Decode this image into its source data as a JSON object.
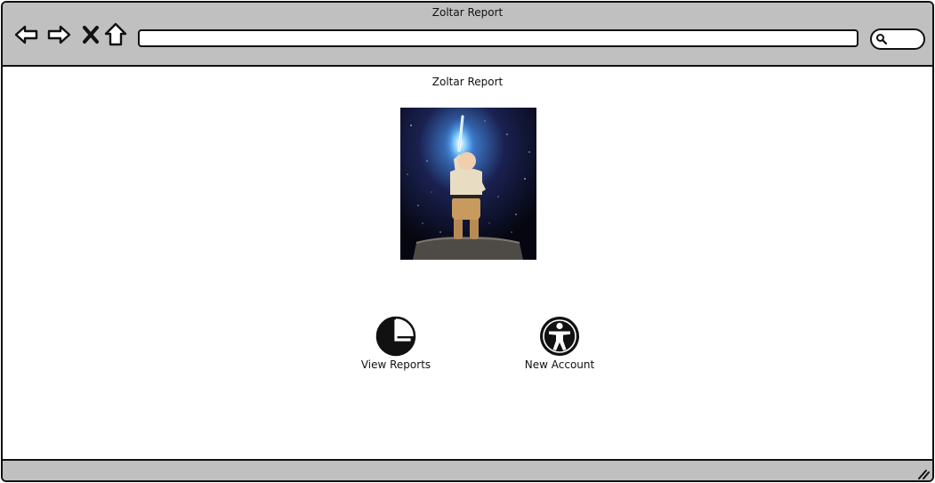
{
  "window": {
    "title": "Zoltar Report"
  },
  "toolbar": {
    "back_icon": "arrow-left-icon",
    "forward_icon": "arrow-right-icon",
    "stop_icon": "close-icon",
    "home_icon": "home-icon",
    "address_value": "",
    "search_icon": "search-icon"
  },
  "page": {
    "heading": "Zoltar Report",
    "hero_image": "child-with-lightsaber-image",
    "actions": [
      {
        "label": "View Reports",
        "icon": "clock-icon"
      },
      {
        "label": "New Account",
        "icon": "person-icon"
      }
    ]
  },
  "colors": {
    "chrome": "#c0c0c0",
    "ink": "#111111",
    "background": "#ffffff"
  }
}
